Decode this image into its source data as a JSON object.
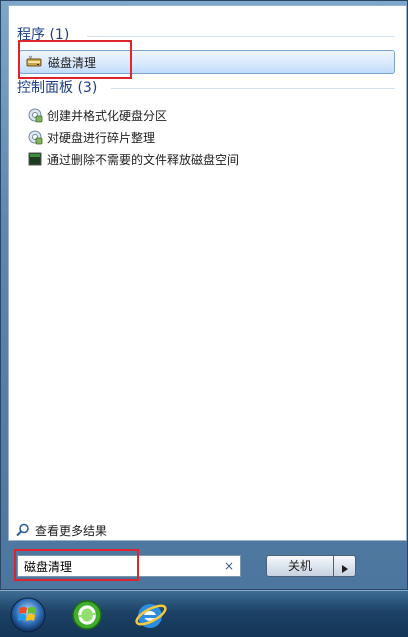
{
  "programs_group": {
    "header": "程序 (1)",
    "items": [
      {
        "label": "磁盘清理",
        "icon": "disk-cleanup-icon"
      }
    ]
  },
  "control_panel_group": {
    "header": "控制面板 (3)",
    "items": [
      {
        "label": "创建并格式化硬盘分区",
        "icon": "control-panel-gear-icon"
      },
      {
        "label": "对硬盘进行碎片整理",
        "icon": "control-panel-gear-icon"
      },
      {
        "label": "通过删除不需要的文件释放磁盘空间",
        "icon": "disk-cleanup-icon"
      }
    ]
  },
  "see_more": {
    "label": "查看更多结果",
    "icon": "search-icon"
  },
  "search": {
    "value": "磁盘清理",
    "clear_icon": "×"
  },
  "shutdown": {
    "label": "关机",
    "arrow_icon": "triangle-right-icon"
  },
  "taskbar": {
    "items": [
      "windows-start-orb-icon",
      "360-browser-icon",
      "internet-explorer-icon"
    ]
  },
  "colors": {
    "highlight_box": "#e0242e",
    "group_header": "#1e3f86",
    "selected_item_bg": "#c1dcfc"
  }
}
